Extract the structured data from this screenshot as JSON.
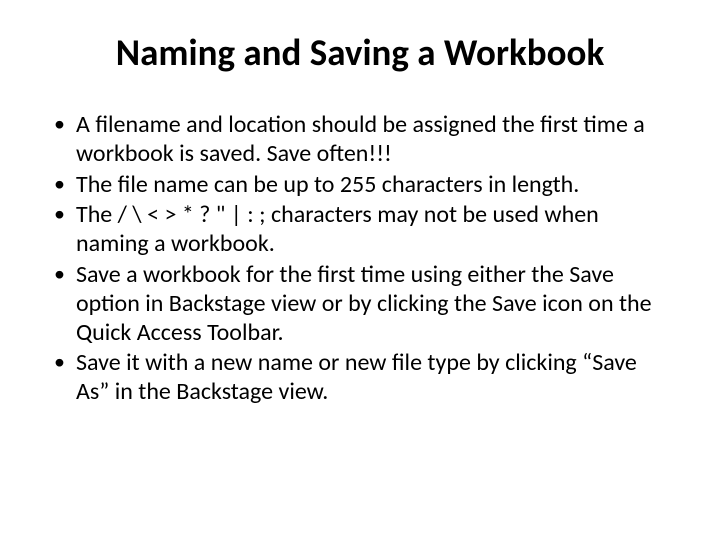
{
  "title": "Naming and Saving a Workbook",
  "bullets": [
    "A filename and location should be assigned the first time a workbook is saved. Save often!!!",
    "The file name can be up to 255 characters in length.",
    "The / \\ < > * ? \" | : ; characters may not be used when naming a workbook.",
    "Save a workbook for the first time using either the Save option in Backstage view or by clicking the Save icon on the Quick Access Toolbar.",
    "Save it with a new name or new file type by clicking “Save As” in the Backstage view."
  ]
}
